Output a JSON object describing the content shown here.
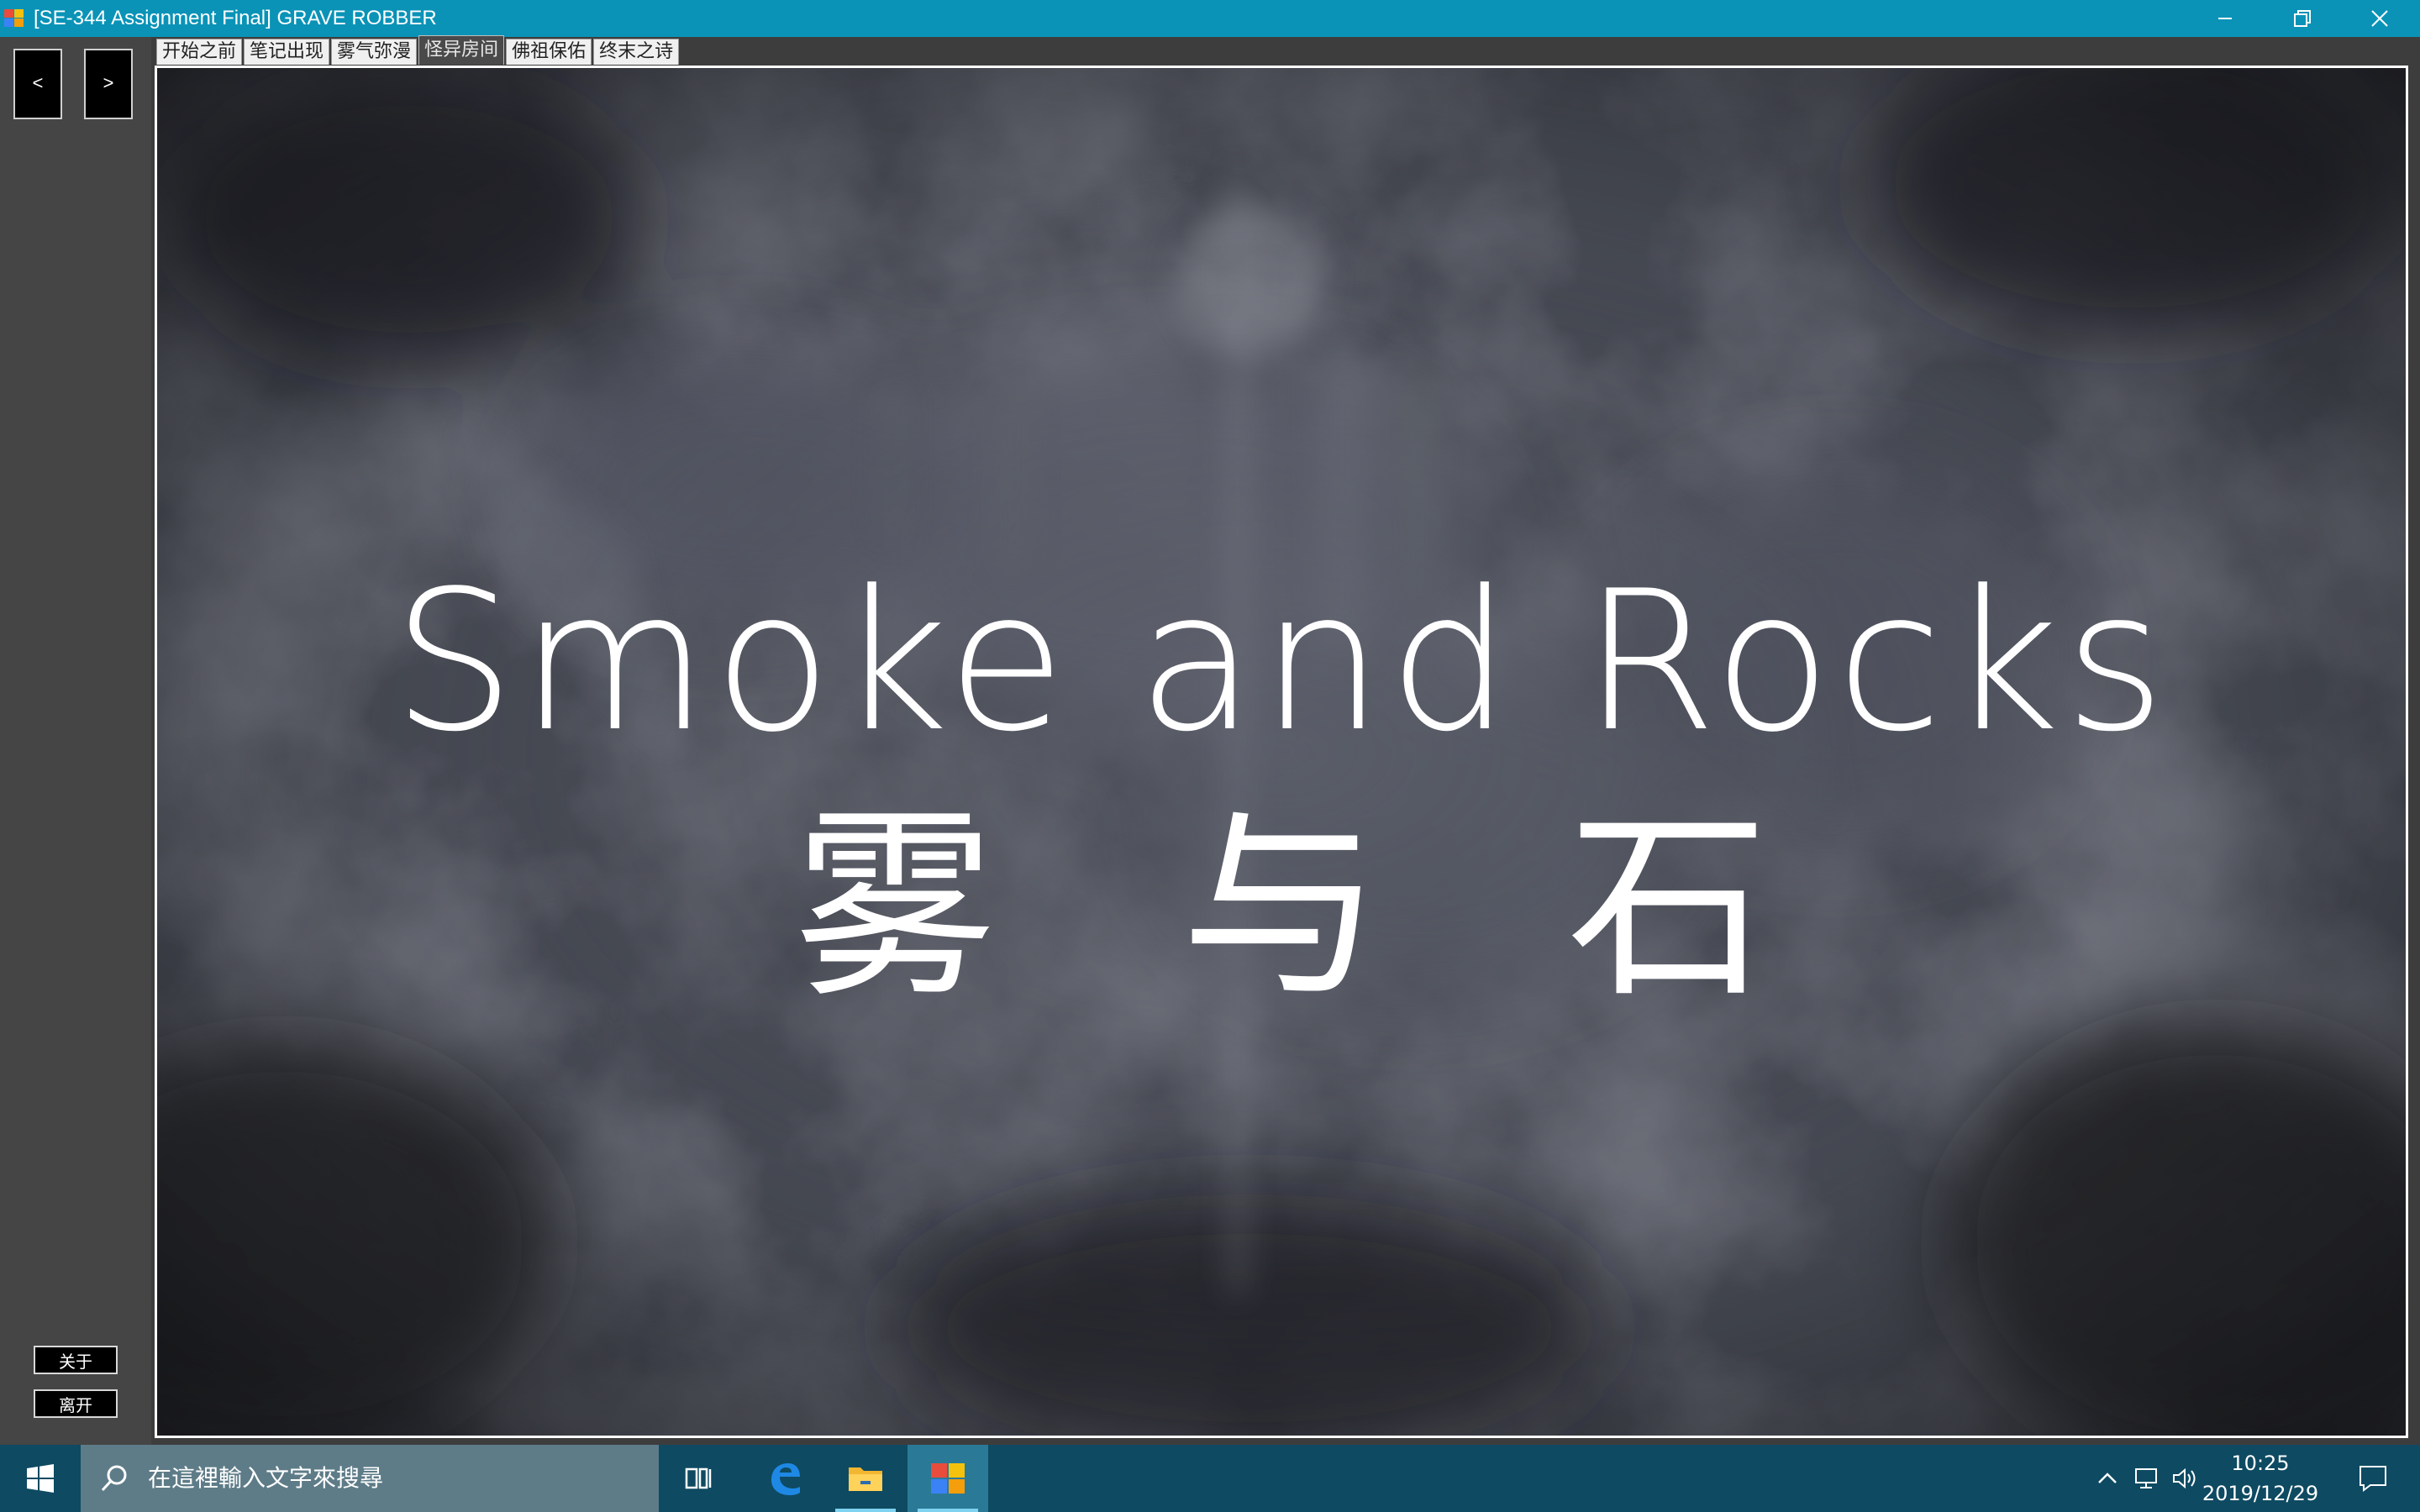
{
  "window": {
    "title": "[SE-344 Assignment Final] GRAVE ROBBER",
    "controls": [
      "minimize",
      "restore",
      "close"
    ]
  },
  "navigation": {
    "prev_label": "<",
    "next_label": ">"
  },
  "tabs": [
    {
      "label": "开始之前",
      "active": false
    },
    {
      "label": "笔记出现",
      "active": false
    },
    {
      "label": "雾气弥漫",
      "active": false
    },
    {
      "label": "怪异房间",
      "active": true
    },
    {
      "label": "佛祖保佑",
      "active": false
    },
    {
      "label": "终末之诗",
      "active": false
    }
  ],
  "sidebar": {
    "about_label": "关于",
    "exit_label": "离开"
  },
  "stage": {
    "title_en": "Smoke and Rocks",
    "title_cn": "雾与石"
  },
  "taskbar": {
    "search_placeholder": "在這裡輸入文字來搜尋",
    "apps": [
      {
        "name": "task-view-icon",
        "running": false,
        "active": false
      },
      {
        "name": "edge-icon",
        "running": false,
        "active": false
      },
      {
        "name": "file-explorer-icon",
        "running": true,
        "active": false
      },
      {
        "name": "grave-robber-app-icon",
        "running": true,
        "active": true
      }
    ],
    "tray": [
      "chevron-up-icon",
      "network-icon",
      "volume-icon"
    ],
    "time": "10:25",
    "date": "2019/12/29"
  },
  "colors": {
    "titlebar": "#0a93b7",
    "taskbar": "#0e4a62",
    "search_box": "#5e7c88",
    "client_bg": "#3d3d3d",
    "accent": "#7fd3f0"
  }
}
